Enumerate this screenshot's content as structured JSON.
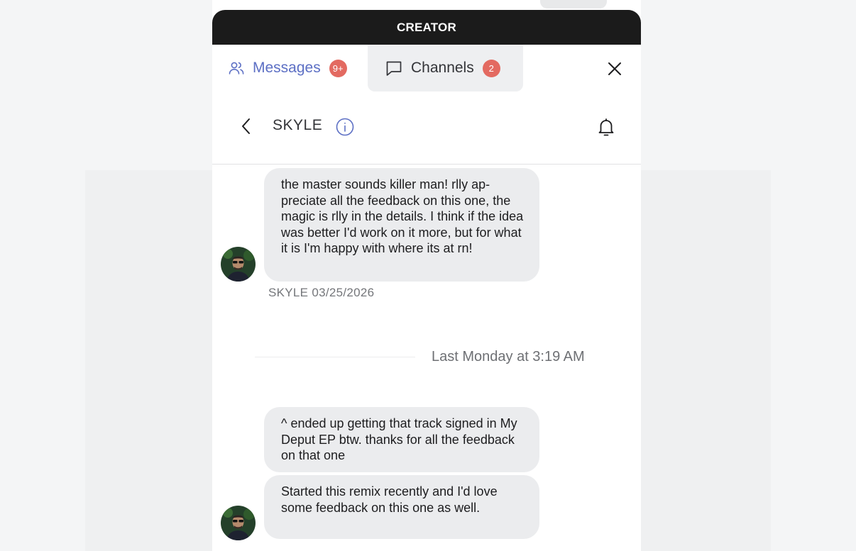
{
  "app": {
    "banner": "CREATOR"
  },
  "tabs": {
    "messages": {
      "label": "Messages",
      "badge": "9+",
      "icon": "users-icon"
    },
    "channels": {
      "label": "Channels",
      "badge": "2",
      "icon": "chat-bubble-icon"
    }
  },
  "chat": {
    "channel_name": "SKYLE"
  },
  "messages": [
    {
      "text": "the master sounds killer man! rlly ap-preciate all the feedback on this one, the magic is rlly in the details. I think if the idea was better I'd work on it more, but for what it is I'm happy with where its at rn!",
      "meta": "SKYLE 03/25/2026"
    },
    {
      "text": "^ ended up getting that track signed in My Deput EP btw. thanks for all the feedback on that one"
    },
    {
      "text": "Started this remix recently and I'd love some feedback on this one as well."
    }
  ],
  "separator": {
    "label": "Last Monday at 3:19 AM"
  },
  "colors": {
    "accent": "#5c6fc4",
    "badge": "#e36a61",
    "banner_bg": "#1b1b1b",
    "bubble_bg": "#ebecee"
  }
}
